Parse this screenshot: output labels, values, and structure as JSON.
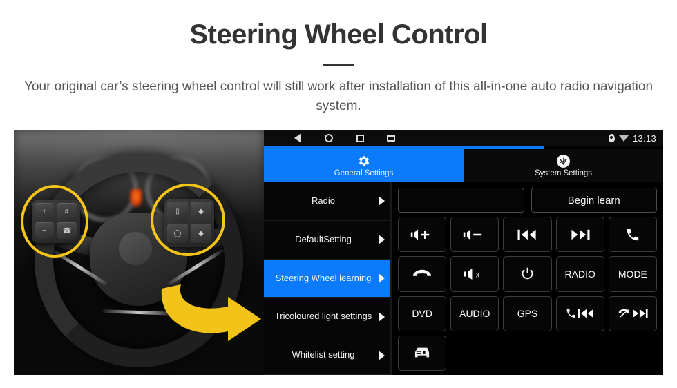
{
  "header": {
    "title": "Steering Wheel Control",
    "subtitle": "Your original car’s steering wheel control will still work after installation of this all-in-one auto radio navigation system."
  },
  "colors": {
    "accent_blue": "#0b7bfb",
    "highlight_yellow": "#f5c518",
    "title_dark": "#333333",
    "screen_black": "#000000"
  },
  "photo": {
    "alt": "grayscale-steering-wheel-photo",
    "highlight_circles": 2,
    "arrow": "yellow-curved-arrow-pointing-right",
    "left_pad_keys": [
      "+",
      "−",
      "voice",
      "call"
    ],
    "right_pad_keys": [
      "display",
      "up",
      "menu",
      "down"
    ]
  },
  "device": {
    "statusbar": {
      "nav_icons": [
        "back-icon",
        "home-icon",
        "recents-icon",
        "screenshot-icon"
      ],
      "status_icons": [
        "location-pin-icon",
        "wifi-icon"
      ],
      "time": "13:13"
    },
    "tabs": [
      {
        "label": "General Settings",
        "icon": "gear-icon",
        "active": true
      },
      {
        "label": "System Settings",
        "icon": "vg-logo-icon",
        "active": false
      }
    ],
    "menu": [
      {
        "label": "Radio",
        "active": false
      },
      {
        "label": "DefaultSetting",
        "active": false
      },
      {
        "label": "Steering Wheel learning",
        "active": true
      },
      {
        "label": "Tricoloured light settings",
        "active": false
      },
      {
        "label": "Whitelist setting",
        "active": false
      }
    ],
    "panel": {
      "display_value": "",
      "begin_learn_label": "Begin learn",
      "buttons": [
        {
          "name": "volume-up-button",
          "icon": "speaker-plus-icon",
          "label": ""
        },
        {
          "name": "volume-down-button",
          "icon": "speaker-minus-icon",
          "label": ""
        },
        {
          "name": "previous-track-button",
          "icon": "previous-icon",
          "label": ""
        },
        {
          "name": "next-track-button",
          "icon": "next-icon",
          "label": ""
        },
        {
          "name": "call-button",
          "icon": "phone-icon",
          "label": ""
        },
        {
          "name": "hangup-button",
          "icon": "phone-hangup-icon",
          "label": ""
        },
        {
          "name": "mute-button",
          "icon": "speaker-mute-icon",
          "label": ""
        },
        {
          "name": "power-button",
          "icon": "power-icon",
          "label": ""
        },
        {
          "name": "radio-button",
          "icon": "",
          "label": "RADIO"
        },
        {
          "name": "mode-button",
          "icon": "",
          "label": "MODE"
        },
        {
          "name": "dvd-button",
          "icon": "",
          "label": "DVD"
        },
        {
          "name": "audio-button",
          "icon": "",
          "label": "AUDIO"
        },
        {
          "name": "gps-button",
          "icon": "",
          "label": "GPS"
        },
        {
          "name": "call-previous-button",
          "icon": "phone-previous-icon",
          "label": ""
        },
        {
          "name": "hangup-next-button",
          "icon": "phone-next-icon",
          "label": ""
        },
        {
          "name": "vehicle-info-button",
          "icon": "car-icon",
          "label": ""
        }
      ]
    }
  }
}
